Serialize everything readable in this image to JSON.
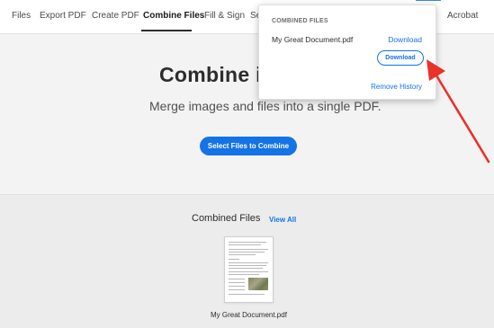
{
  "nav": {
    "tabs": [
      {
        "label": "Files"
      },
      {
        "label": "Export PDF"
      },
      {
        "label": "Create PDF"
      },
      {
        "label": "Combine Files"
      },
      {
        "label": "Fill & Sign"
      },
      {
        "label": "Se"
      }
    ],
    "active_tab": "Combine Files",
    "right_label": "Acrobat"
  },
  "hero": {
    "title": "Combine i",
    "subtitle": "Merge images and files into a single PDF.",
    "select_button": "Select Files to Combine"
  },
  "combined": {
    "heading": "Combined Files",
    "view_all": "View All",
    "file_name": "My Great Document.pdf"
  },
  "popover": {
    "header": "COMBINED FILES",
    "file_name": "My Great Document.pdf",
    "download_link": "Download",
    "download_button": "Download",
    "remove_history": "Remove History"
  },
  "colors": {
    "accent": "#1473e6",
    "annotation_arrow": "#e8322a"
  }
}
